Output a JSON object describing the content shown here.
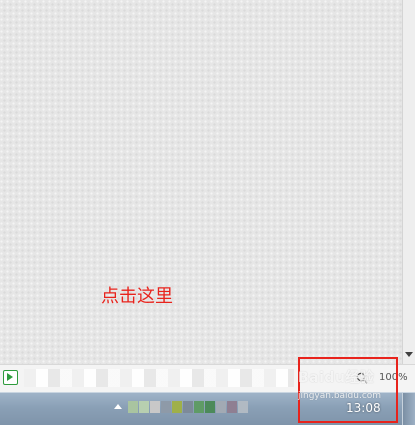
{
  "annotation": {
    "text": "点击这里"
  },
  "statusbar": {
    "zoom_level": "100%"
  },
  "taskbar": {
    "clock": "13:08",
    "tray_colors": [
      "#a9c4a0",
      "#b7cfb0",
      "#c8c8c8",
      "#8e9aa8",
      "#9fb04a",
      "#7d8a99",
      "#5f9b66",
      "#4c8a5a",
      "#a2aab4",
      "#8f7f92",
      "#b1bac3"
    ]
  },
  "watermark": {
    "title": "Baidu经验",
    "url": "jingyan.baidu.com"
  },
  "colors": {
    "annotation": "#e8231c",
    "highlight": "#e8231c",
    "accent_green": "#2e9b3d"
  }
}
